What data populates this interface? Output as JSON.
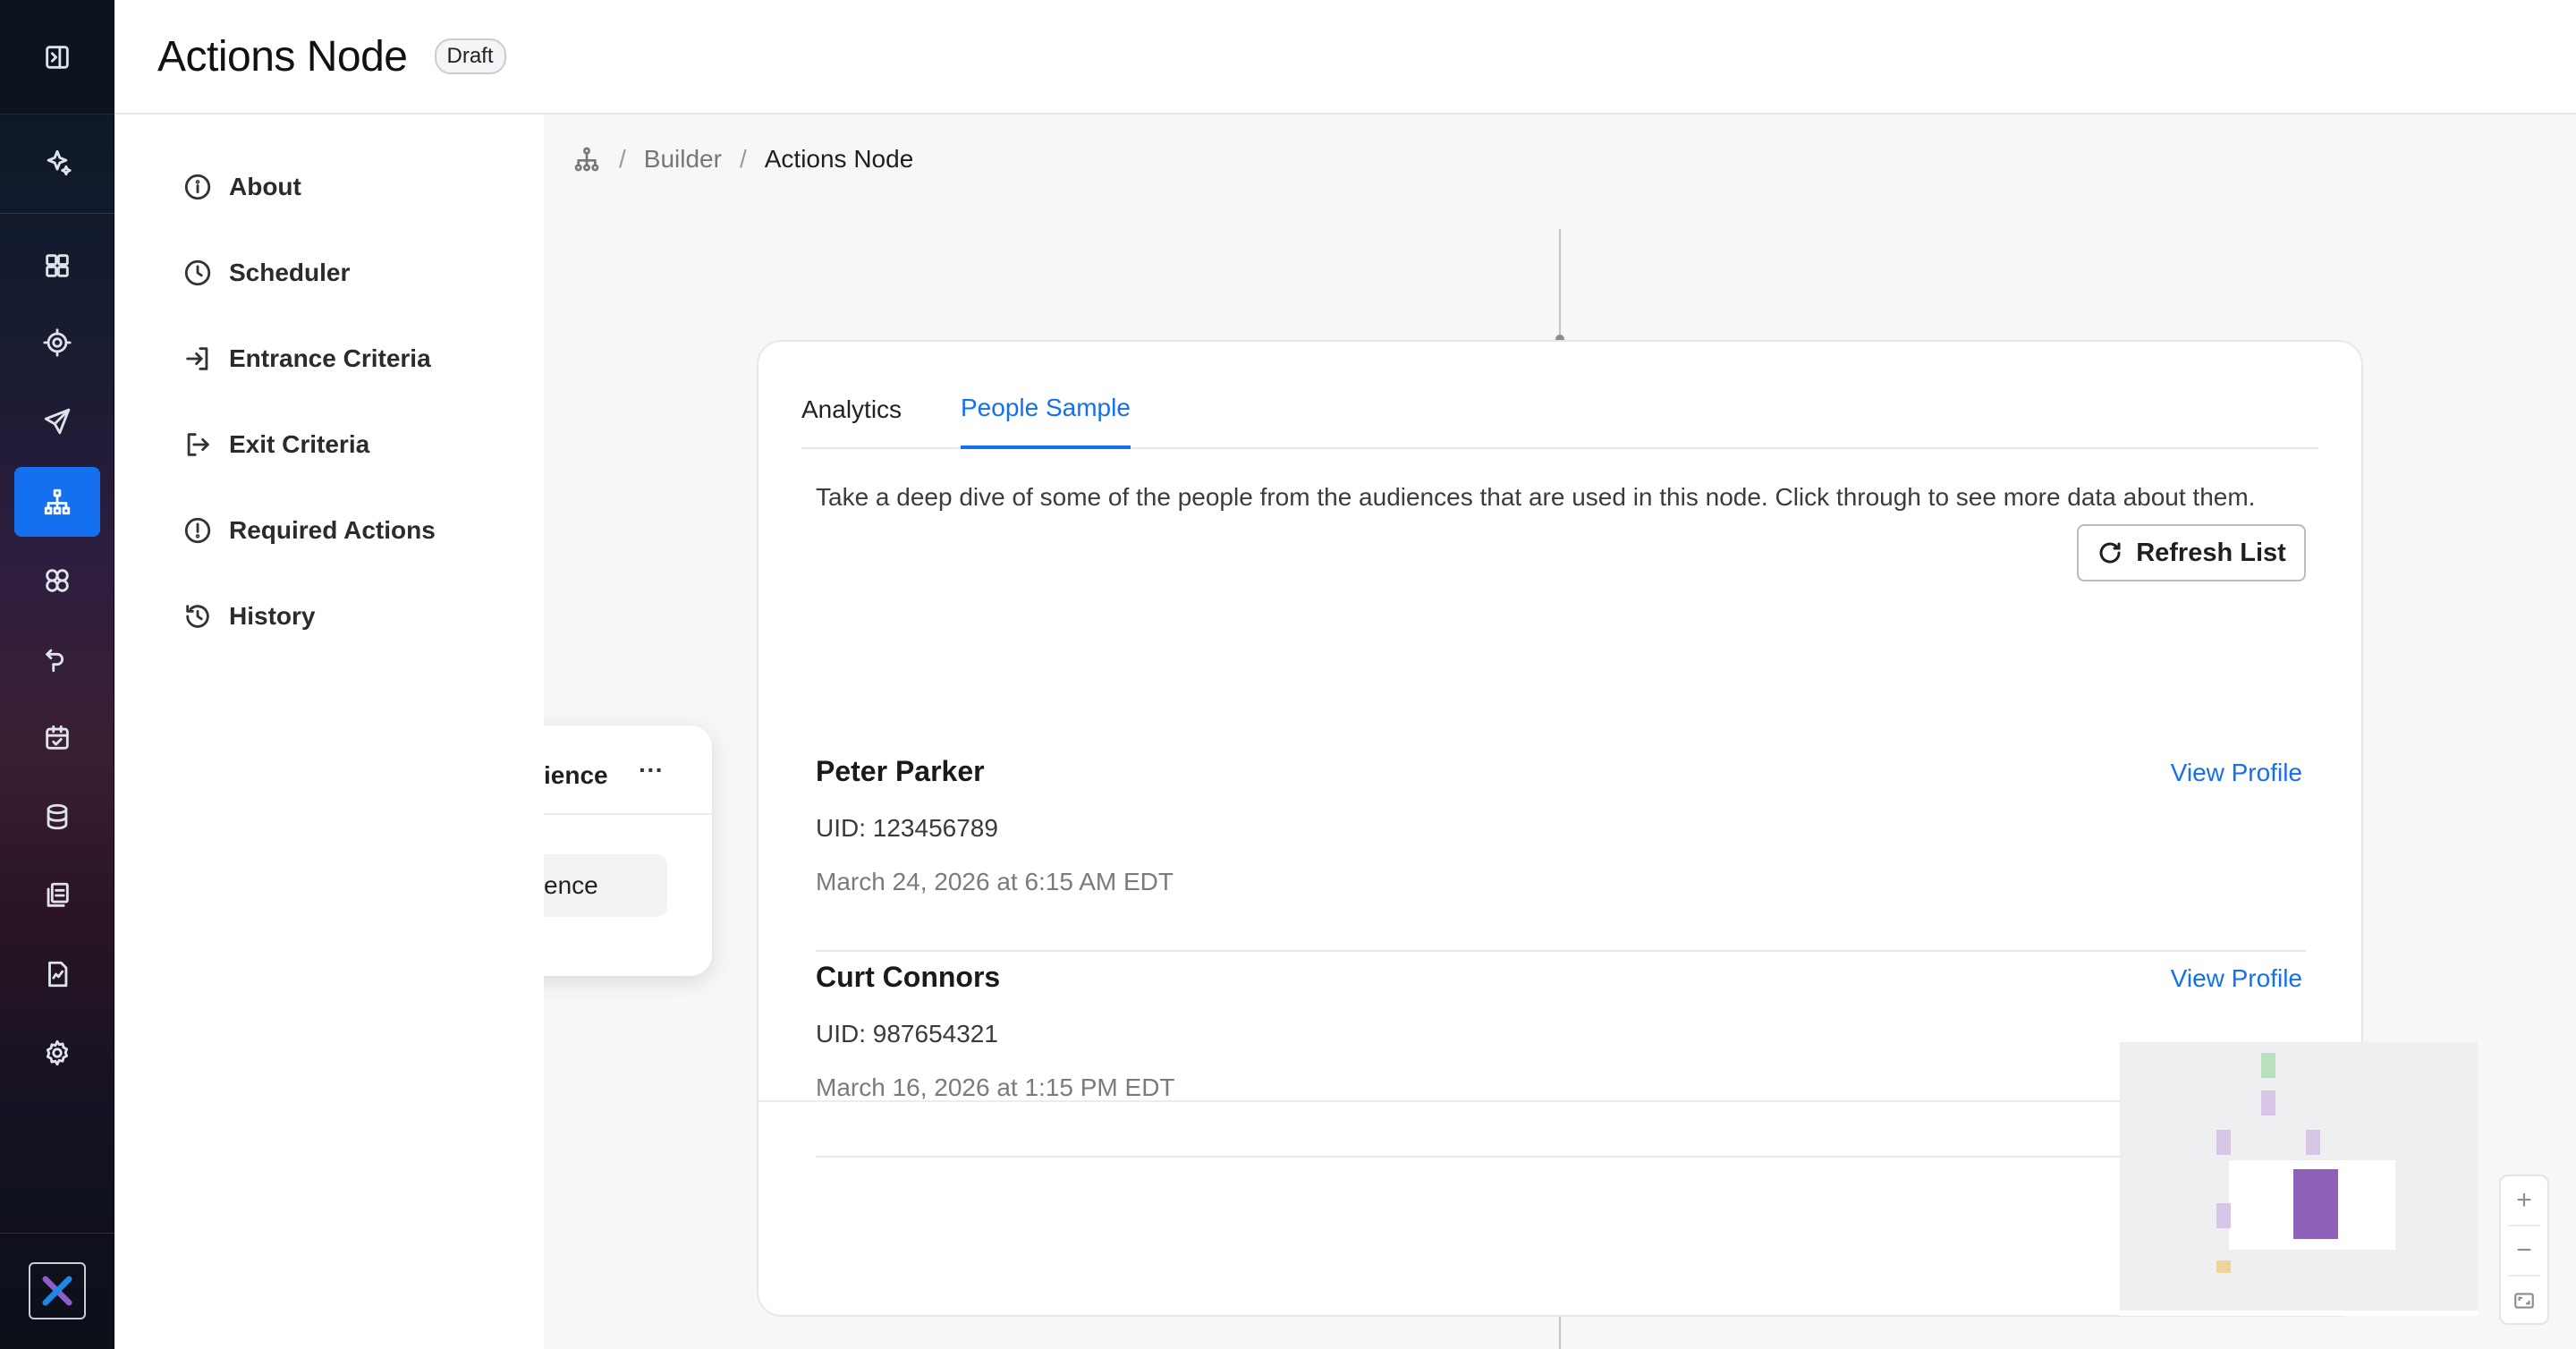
{
  "header": {
    "title": "Actions Node",
    "badge": "Draft"
  },
  "rail": {
    "items": [
      {
        "name": "expand-sidebar-icon"
      },
      {
        "name": "sparkle-ai-icon"
      },
      {
        "name": "dashboard-grid-icon"
      },
      {
        "name": "target-icon"
      },
      {
        "name": "send-icon"
      },
      {
        "name": "flow-builder-icon",
        "active": true
      },
      {
        "name": "audiences-icon"
      },
      {
        "name": "journey-icon"
      },
      {
        "name": "calendar-icon"
      },
      {
        "name": "database-icon"
      },
      {
        "name": "library-icon"
      },
      {
        "name": "report-icon"
      },
      {
        "name": "settings-gear-icon"
      }
    ],
    "logo": "brand-logo",
    "accent": "#1570ef"
  },
  "subnav": {
    "items": [
      {
        "label": "About",
        "icon": "info-icon"
      },
      {
        "label": "Scheduler",
        "icon": "clock-icon"
      },
      {
        "label": "Entrance Criteria",
        "icon": "sign-in-icon"
      },
      {
        "label": "Exit Criteria",
        "icon": "sign-out-icon"
      },
      {
        "label": "Required Actions",
        "icon": "alert-circle-icon"
      },
      {
        "label": "History",
        "icon": "history-icon"
      }
    ]
  },
  "breadcrumb": {
    "icon": "hierarchy-icon",
    "items": [
      "Builder",
      "Actions Node"
    ]
  },
  "side_node": {
    "title": "ience",
    "menu": "···",
    "pill": "ence"
  },
  "panel": {
    "tabs": [
      {
        "label": "Analytics",
        "active": false
      },
      {
        "label": "People Sample",
        "active": true
      }
    ],
    "description": "Take a deep dive of some of the people from the audiences that are used in this node. Click through to see more data about them.",
    "refresh_label": "Refresh List",
    "people": [
      {
        "name": "Peter Parker",
        "uid": "UID: 123456789",
        "date": "March 24, 2026 at 6:15 AM EDT",
        "link": "View Profile"
      },
      {
        "name": "Curt Connors",
        "uid": "UID: 987654321",
        "date": "March 16, 2026 at 1:15 PM EDT",
        "link": "View Profile"
      }
    ]
  },
  "zoom": {
    "in": "+",
    "out": "−"
  },
  "colors": {
    "link": "#1570ef",
    "minimap_primary": "#8e60b8",
    "minimap_green": "#b9e0bd",
    "minimap_purple": "#d7c6e6",
    "minimap_yellow": "#f1d49a"
  }
}
